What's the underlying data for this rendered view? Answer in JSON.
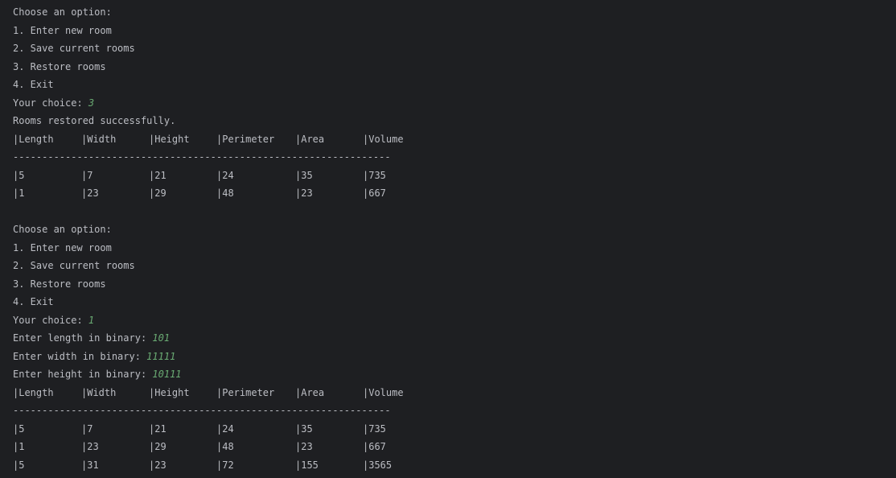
{
  "menu": {
    "prompt": "Choose an option:",
    "items": [
      "1. Enter new room",
      "2. Save current rooms",
      "3. Restore rooms",
      "4. Exit"
    ],
    "choice_label": "Your choice: "
  },
  "session1": {
    "choice": "3",
    "message": "Rooms restored successfully.",
    "table": {
      "headers": [
        "|Length",
        "|Width",
        "|Height",
        "|Perimeter",
        "|Area",
        "|Volume"
      ],
      "separator": "-----------------------------------------------------------------",
      "rows": [
        [
          "|5",
          "|7",
          "|21",
          "|24",
          "|35",
          "|735"
        ],
        [
          "|1",
          "|23",
          "|29",
          "|48",
          "|23",
          "|667"
        ]
      ]
    }
  },
  "session2": {
    "choice": "1",
    "prompts": [
      {
        "label": "Enter length in binary: ",
        "value": "101"
      },
      {
        "label": "Enter width in binary: ",
        "value": "11111"
      },
      {
        "label": "Enter height in binary: ",
        "value": "10111"
      }
    ],
    "table": {
      "headers": [
        "|Length",
        "|Width",
        "|Height",
        "|Perimeter",
        "|Area",
        "|Volume"
      ],
      "separator": "-----------------------------------------------------------------",
      "rows": [
        [
          "|5",
          "|7",
          "|21",
          "|24",
          "|35",
          "|735"
        ],
        [
          "|1",
          "|23",
          "|29",
          "|48",
          "|23",
          "|667"
        ],
        [
          "|5",
          "|31",
          "|23",
          "|72",
          "|155",
          "|3565"
        ]
      ]
    }
  },
  "colors": {
    "background": "#1e1f22",
    "text": "#bcbec4",
    "user_input": "#6aab73"
  }
}
